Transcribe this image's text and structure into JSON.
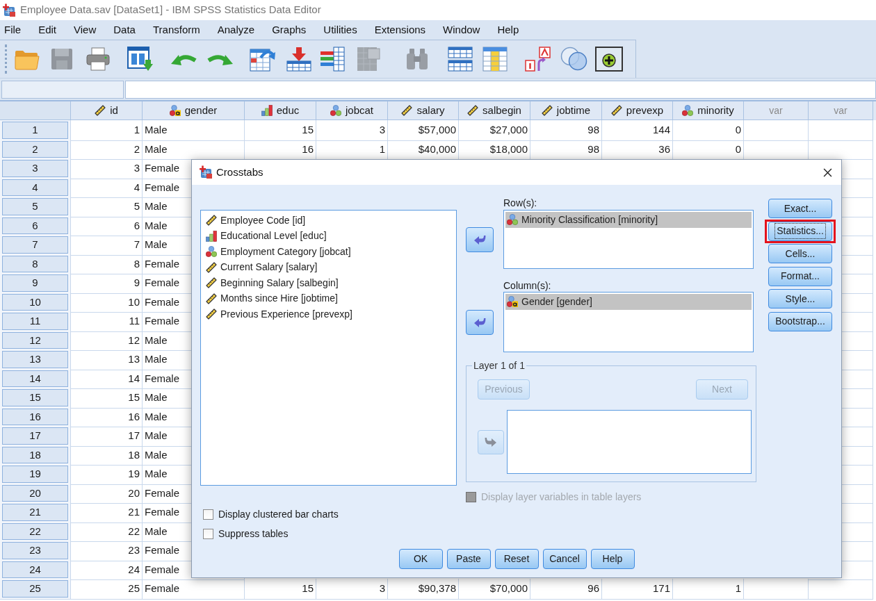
{
  "window": {
    "title": "Employee Data.sav [DataSet1] - IBM SPSS Statistics Data Editor"
  },
  "menu": [
    "File",
    "Edit",
    "View",
    "Data",
    "Transform",
    "Analyze",
    "Graphs",
    "Utilities",
    "Extensions",
    "Window",
    "Help"
  ],
  "toolbar": [
    {
      "kind": "open",
      "disabled": false
    },
    {
      "kind": "save",
      "disabled": true
    },
    {
      "kind": "print",
      "disabled": false
    },
    {
      "kind": "recall",
      "disabled": false
    },
    {
      "kind": "undo",
      "disabled": false
    },
    {
      "kind": "redo",
      "disabled": false
    },
    {
      "kind": "goto_case",
      "disabled": false
    },
    {
      "kind": "goto_variable",
      "disabled": false
    },
    {
      "kind": "variables",
      "disabled": false
    },
    {
      "kind": "descriptives",
      "disabled": true
    },
    {
      "kind": "find",
      "disabled": true
    },
    {
      "kind": "insert_cases",
      "disabled": false
    },
    {
      "kind": "insert_variable",
      "disabled": false
    },
    {
      "kind": "split_file",
      "disabled": false
    },
    {
      "kind": "weight_cases",
      "disabled": false
    },
    {
      "kind": "select_cases",
      "disabled": false
    }
  ],
  "data_view": {
    "columns": [
      {
        "name": "id",
        "kind": "scale"
      },
      {
        "name": "gender",
        "kind": "nominal_string"
      },
      {
        "name": "educ",
        "kind": "ordinal"
      },
      {
        "name": "jobcat",
        "kind": "nominal"
      },
      {
        "name": "salary",
        "kind": "scale"
      },
      {
        "name": "salbegin",
        "kind": "scale"
      },
      {
        "name": "jobtime",
        "kind": "scale"
      },
      {
        "name": "prevexp",
        "kind": "scale"
      },
      {
        "name": "minority",
        "kind": "nominal"
      },
      {
        "name": "var",
        "kind": "empty"
      },
      {
        "name": "var",
        "kind": "empty"
      }
    ],
    "rows": [
      {
        "number": "1",
        "cells": [
          "1",
          "Male",
          "15",
          "3",
          "$57,000",
          "$27,000",
          "98",
          "144",
          "0"
        ]
      },
      {
        "number": "2",
        "cells": [
          "2",
          "Male",
          "16",
          "1",
          "$40,000",
          "$18,000",
          "98",
          "36",
          "0"
        ]
      },
      {
        "number": "3",
        "cells": [
          "3",
          "Female"
        ]
      },
      {
        "number": "4",
        "cells": [
          "4",
          "Female"
        ]
      },
      {
        "number": "5",
        "cells": [
          "5",
          "Male"
        ]
      },
      {
        "number": "6",
        "cells": [
          "6",
          "Male"
        ]
      },
      {
        "number": "7",
        "cells": [
          "7",
          "Male"
        ]
      },
      {
        "number": "8",
        "cells": [
          "8",
          "Female"
        ]
      },
      {
        "number": "9",
        "cells": [
          "9",
          "Female"
        ]
      },
      {
        "number": "10",
        "cells": [
          "10",
          "Female"
        ]
      },
      {
        "number": "11",
        "cells": [
          "11",
          "Female"
        ]
      },
      {
        "number": "12",
        "cells": [
          "12",
          "Male"
        ]
      },
      {
        "number": "13",
        "cells": [
          "13",
          "Male"
        ]
      },
      {
        "number": "14",
        "cells": [
          "14",
          "Female"
        ]
      },
      {
        "number": "15",
        "cells": [
          "15",
          "Male"
        ]
      },
      {
        "number": "16",
        "cells": [
          "16",
          "Male"
        ]
      },
      {
        "number": "17",
        "cells": [
          "17",
          "Male"
        ]
      },
      {
        "number": "18",
        "cells": [
          "18",
          "Male"
        ]
      },
      {
        "number": "19",
        "cells": [
          "19",
          "Male"
        ]
      },
      {
        "number": "20",
        "cells": [
          "20",
          "Female"
        ]
      },
      {
        "number": "21",
        "cells": [
          "21",
          "Female"
        ]
      },
      {
        "number": "22",
        "cells": [
          "22",
          "Male"
        ]
      },
      {
        "number": "23",
        "cells": [
          "23",
          "Female"
        ]
      },
      {
        "number": "24",
        "cells": [
          "24",
          "Female"
        ]
      },
      {
        "number": "25",
        "cells": [
          "25",
          "Female",
          "15",
          "3",
          "$90,378",
          "$70,000",
          "96",
          "171",
          "1"
        ]
      }
    ]
  },
  "dialog": {
    "title": "Crosstabs",
    "source_variables": [
      {
        "label": "Employee Code [id]",
        "kind": "scale",
        "selected": false
      },
      {
        "label": "Educational Level [educ]",
        "kind": "ordinal",
        "selected": false
      },
      {
        "label": "Employment Category [jobcat]",
        "kind": "nominal",
        "selected": false
      },
      {
        "label": "Current Salary [salary]",
        "kind": "scale",
        "selected": false
      },
      {
        "label": "Beginning Salary [salbegin]",
        "kind": "scale",
        "selected": false
      },
      {
        "label": "Months since Hire [jobtime]",
        "kind": "scale",
        "selected": false
      },
      {
        "label": "Previous Experience [prevexp]",
        "kind": "scale",
        "selected": false
      }
    ],
    "rows_box": {
      "label": "Row(s):",
      "move_disabled": false,
      "items": [
        {
          "label": "Minority Classification [minority]",
          "kind": "nominal",
          "selected": true
        }
      ]
    },
    "columns_box": {
      "label": "Column(s):",
      "move_disabled": false,
      "items": [
        {
          "label": "Gender [gender]",
          "kind": "nominal_string",
          "selected": true
        }
      ]
    },
    "side_buttons": [
      {
        "label": "Exact...",
        "focused": false,
        "highlighted": false
      },
      {
        "label": "Statistics...",
        "focused": true,
        "highlighted": true
      },
      {
        "label": "Cells...",
        "focused": false,
        "highlighted": false
      },
      {
        "label": "Format...",
        "focused": false,
        "highlighted": false
      },
      {
        "label": "Style...",
        "focused": false,
        "highlighted": false
      },
      {
        "label": "Bootstrap...",
        "focused": false,
        "highlighted": false
      }
    ],
    "layer": {
      "title": "Layer 1 of 1",
      "previous": {
        "label": "Previous",
        "disabled": true
      },
      "next": {
        "label": "Next",
        "disabled": true
      },
      "move_disabled": true
    },
    "layer_option": {
      "label": "Display layer variables in table layers",
      "checked": false,
      "disabled": true
    },
    "options": [
      {
        "label": "Display clustered bar charts",
        "checked": false
      },
      {
        "label": "Suppress tables",
        "checked": false
      }
    ],
    "buttons": [
      "OK",
      "Paste",
      "Reset",
      "Cancel",
      "Help"
    ]
  }
}
